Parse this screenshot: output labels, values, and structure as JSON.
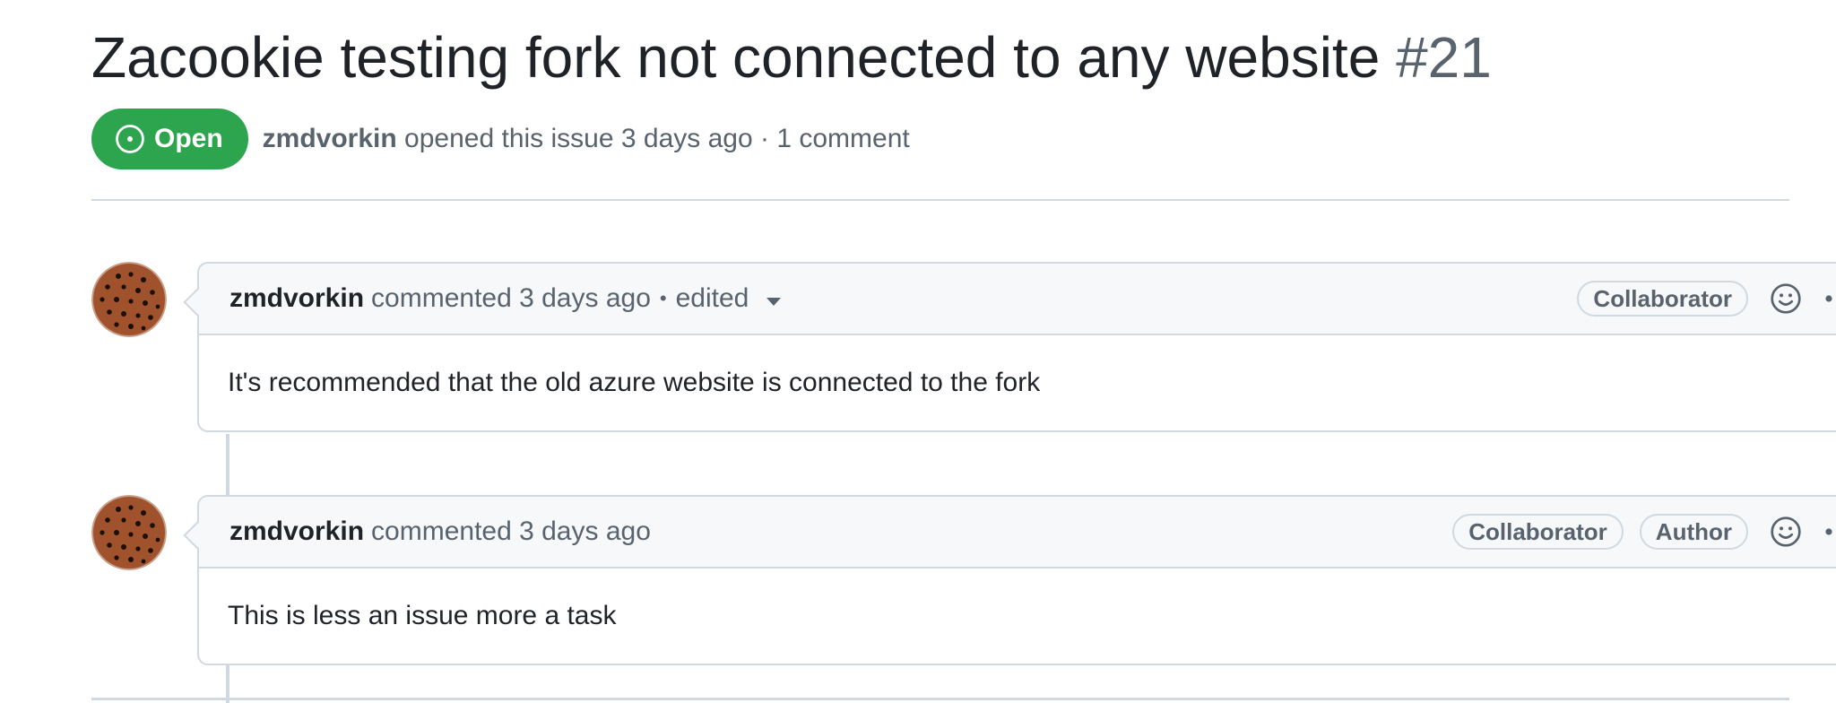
{
  "issue": {
    "title": "Zacookie testing fork not connected to any website",
    "number": "#21",
    "state": "Open",
    "state_color": "#2da44e",
    "author": "zmdvorkin",
    "opened_text": "opened this issue 3 days ago",
    "separator": "·",
    "comments_count_text": "1 comment"
  },
  "comments": [
    {
      "author": "zmdvorkin",
      "action": "commented 3 days ago",
      "separator": "•",
      "edited_label": "edited",
      "badges": [
        "Collaborator"
      ],
      "body": "It's recommended that the old azure website is connected to the fork",
      "icons": [
        "avatar-cookie",
        "smiley-icon",
        "kebab-icon",
        "caret-down-icon"
      ]
    },
    {
      "author": "zmdvorkin",
      "action": "commented 3 days ago",
      "badges": [
        "Collaborator",
        "Author"
      ],
      "body": "This is less an issue more a task",
      "icons": [
        "avatar-cookie",
        "smiley-icon",
        "kebab-icon"
      ]
    }
  ],
  "colors": {
    "text_primary": "#1f2328",
    "text_muted": "#59636e",
    "border": "#d1d9e0",
    "header_bg": "#f6f8fa",
    "avatar_bg": "#a0522d"
  }
}
